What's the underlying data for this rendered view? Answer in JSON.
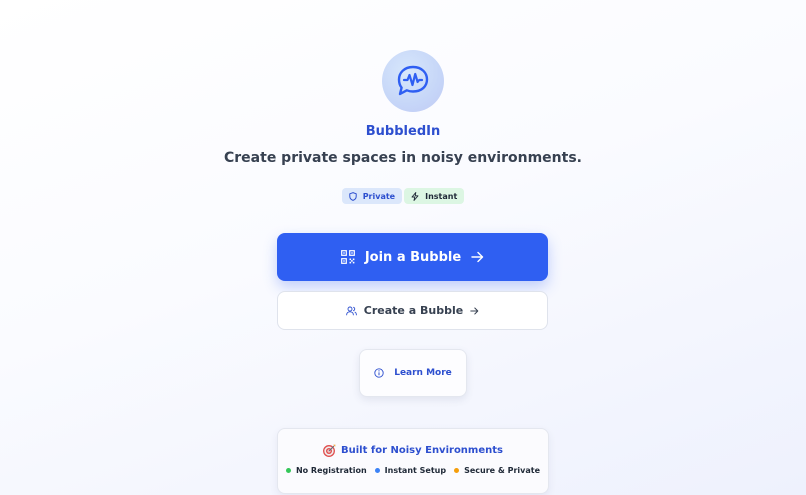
{
  "app": {
    "name": "BubbledIn",
    "tagline": "Create private spaces in noisy environments."
  },
  "logo": {
    "icon": "chat-bubble-waveform-icon",
    "color": "#2f5ff2"
  },
  "badges": [
    {
      "label": "Private",
      "icon": "shield-icon",
      "bg": "#dbe7fb"
    },
    {
      "label": "Instant",
      "icon": "lightning-icon",
      "bg": "#dcf6e3"
    }
  ],
  "actions": {
    "join": {
      "label": "Join a Bubble",
      "icon": "qr-code-icon",
      "trail_icon": "arrow-right-icon"
    },
    "create": {
      "label": "Create a Bubble",
      "icon": "users-icon",
      "trail_icon": "arrow-right-icon"
    },
    "learn": {
      "label": "Learn More",
      "icon": "info-icon"
    }
  },
  "info_card": {
    "icon": "target-icon",
    "title": "Built for Noisy Environments",
    "features": [
      {
        "label": "No Registration",
        "color": "#34c759"
      },
      {
        "label": "Instant Setup",
        "color": "#3b82f6"
      },
      {
        "label": "Secure & Private",
        "color": "#f59e0b"
      }
    ]
  },
  "colors": {
    "accent": "#2f5ff2",
    "brand_text": "#2d4fcf"
  }
}
